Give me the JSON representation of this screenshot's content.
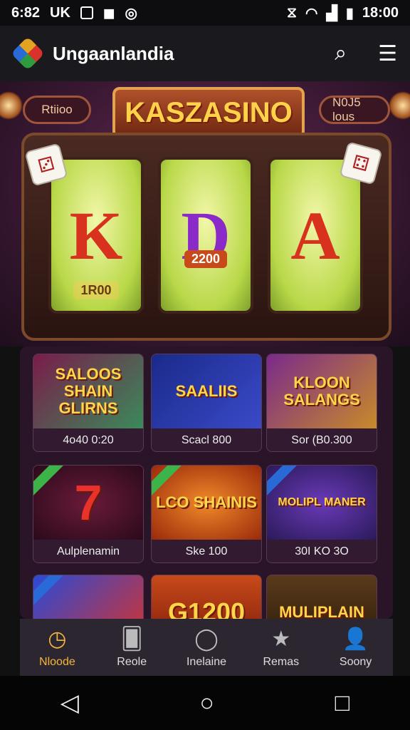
{
  "status": {
    "time_left": "6:82",
    "icons_left": "UK",
    "time_right": "18:00"
  },
  "app": {
    "title": "Ungaanlandia"
  },
  "hero": {
    "left_pill": "Rtiioo",
    "right_pill": "N0J5 lous",
    "banner": "KASZASINO",
    "reels": [
      {
        "letter": "K",
        "sub": "1R00"
      },
      {
        "letter": "D",
        "sub": "2200"
      },
      {
        "letter": "A",
        "sub": ""
      }
    ]
  },
  "games": [
    {
      "title": "SALOOS SHAIN GLIRNS",
      "caption": "4o40 0:20"
    },
    {
      "title": "SAALIIS",
      "caption": "Scacl 800"
    },
    {
      "title": "KLOON SALANGS",
      "caption": "Sor (B0.300"
    },
    {
      "title": "7",
      "caption": "Aulplenamin"
    },
    {
      "title": "LCO SHAINIS",
      "caption": "Ske 100"
    },
    {
      "title": "MOLIPL MANER",
      "caption": "30I KO 3O"
    },
    {
      "title": "",
      "caption": ""
    },
    {
      "title": "G1200",
      "caption": ""
    },
    {
      "title": "MULIPLAIN",
      "caption": ""
    }
  ],
  "nav": [
    {
      "label": "Nloode",
      "icon": "clock-icon",
      "active": true
    },
    {
      "label": "Reole",
      "icon": "cards-icon"
    },
    {
      "label": "Inelaine",
      "icon": "circle-icon"
    },
    {
      "label": "Remas",
      "icon": "star-icon"
    },
    {
      "label": "Soony",
      "icon": "user-icon"
    }
  ]
}
